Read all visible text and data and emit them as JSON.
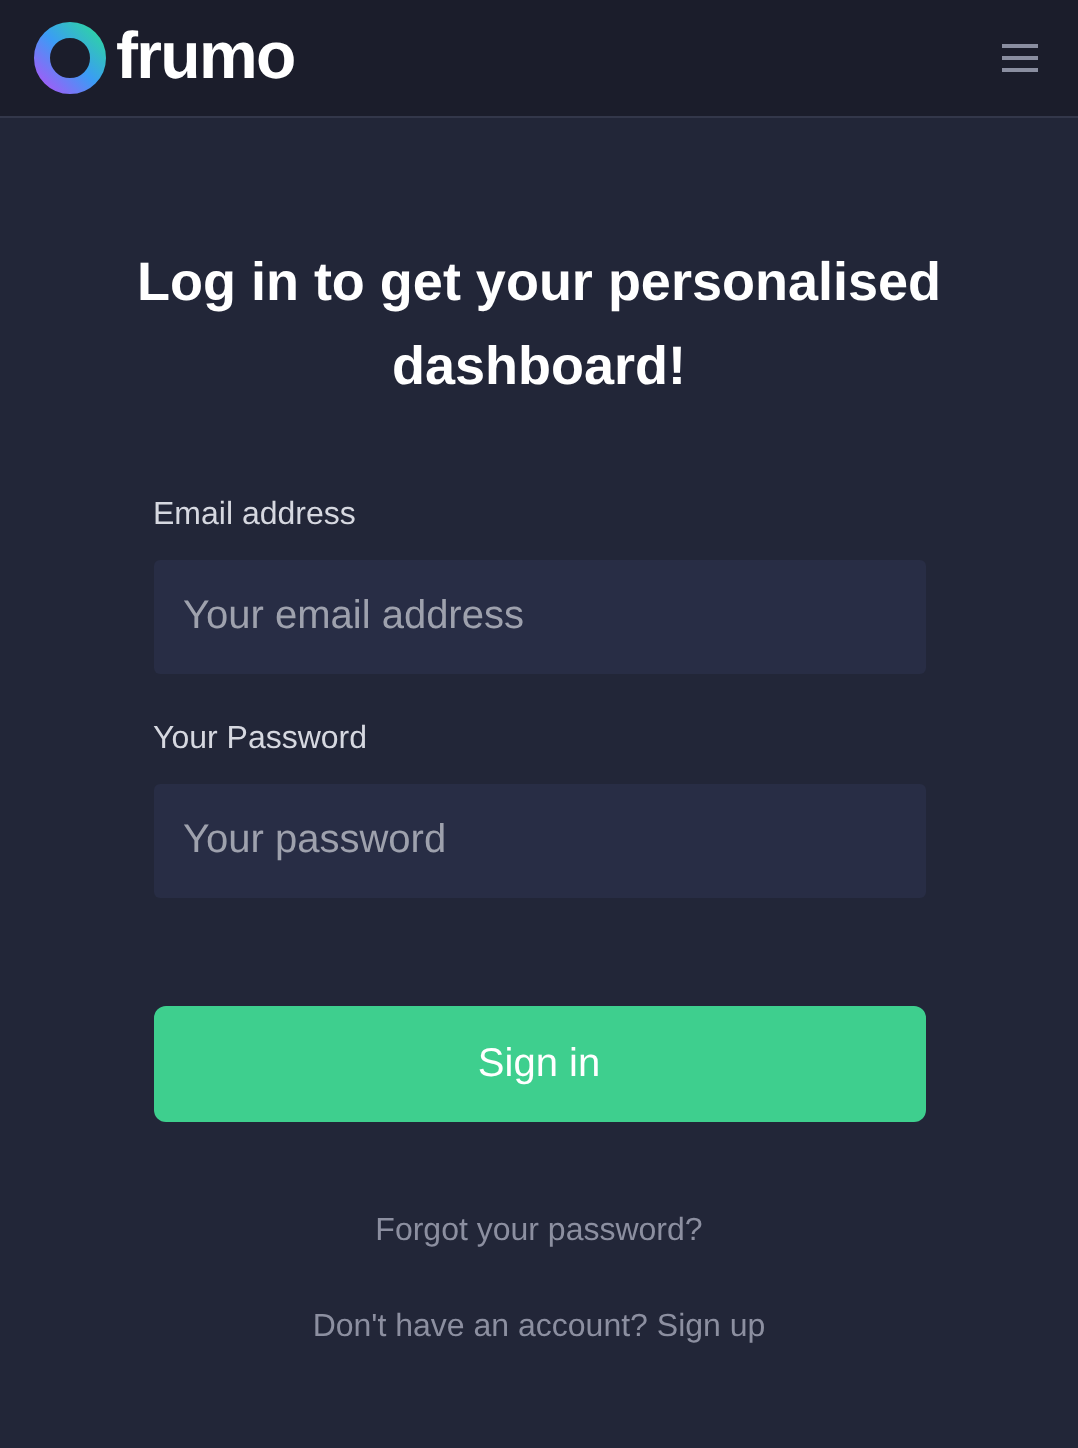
{
  "header": {
    "logo_text": "frumo"
  },
  "heading": "Log in to get your personalised dashboard!",
  "fields": [
    {
      "label": "Email address",
      "placeholder": "Your email address"
    },
    {
      "label": "Your Password",
      "placeholder": "Your password"
    }
  ],
  "submit_button": "Sign in",
  "links": [
    "Forgot your password?",
    "Don't have an account? Sign up"
  ]
}
